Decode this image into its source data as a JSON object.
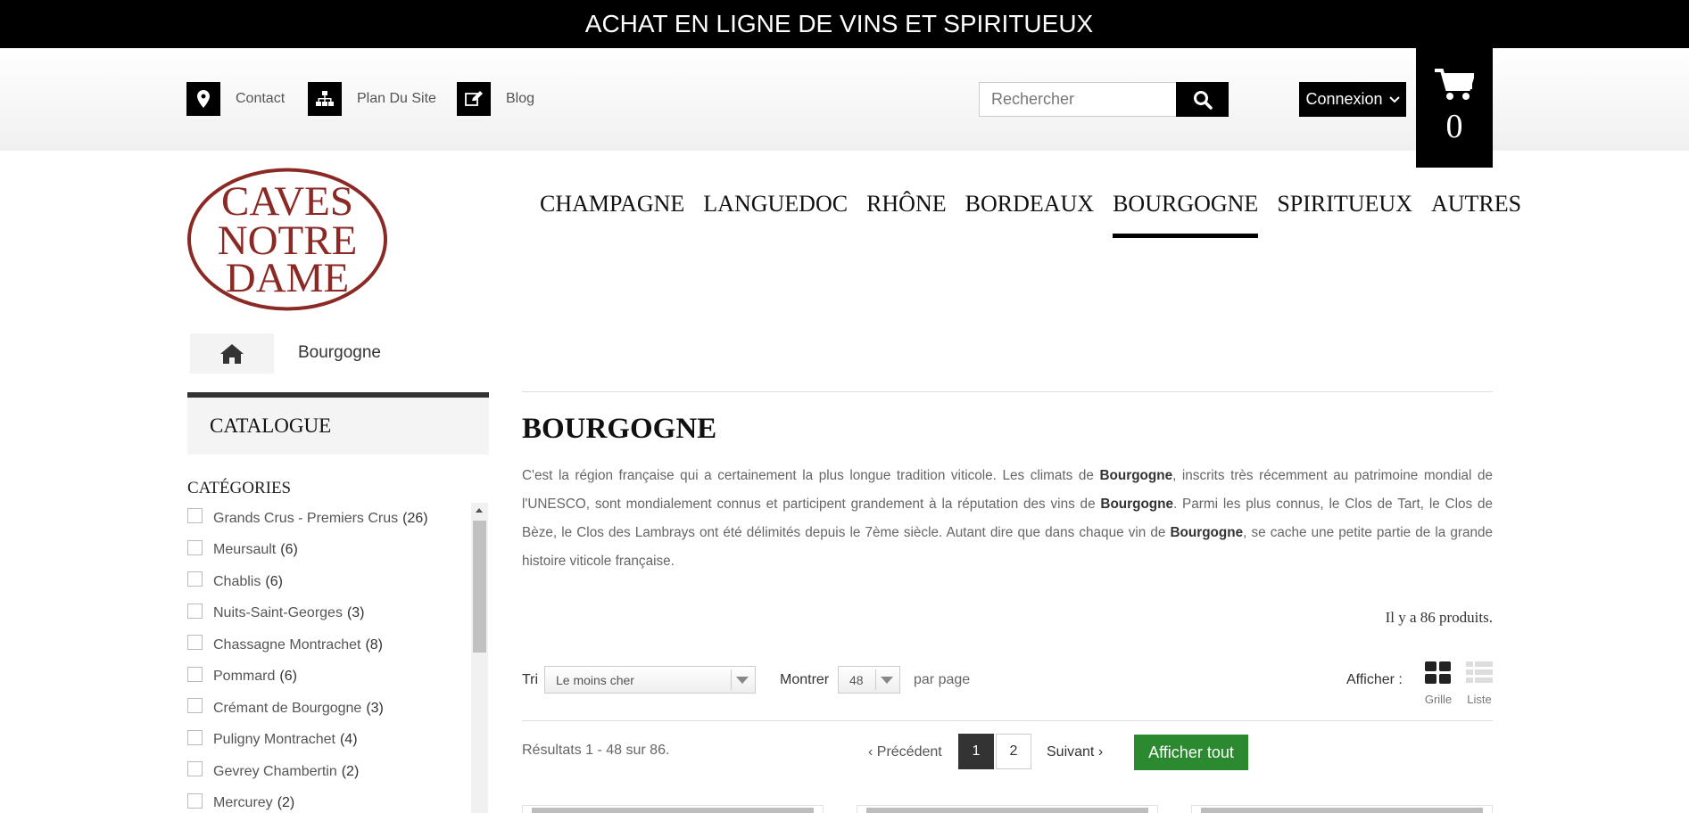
{
  "banner": {
    "title": "ACHAT EN LIGNE DE VINS ET SPIRITUEUX"
  },
  "header": {
    "links": [
      {
        "label": "Contact",
        "icon": "map-marker-icon"
      },
      {
        "label": "Plan Du Site",
        "icon": "sitemap-icon"
      },
      {
        "label": "Blog",
        "icon": "edit-icon"
      }
    ],
    "search": {
      "placeholder": "Rechercher",
      "value": ""
    },
    "login_label": "Connexion",
    "cart_count": "0"
  },
  "logo": {
    "line1": "CAVES",
    "line2": "NOTRE",
    "line3": "DAME"
  },
  "nav": {
    "items": [
      "CHAMPAGNE",
      "LANGUEDOC",
      "RHÔNE",
      "BORDEAUX",
      "BOURGOGNE",
      "SPIRITUEUX",
      "AUTRES"
    ],
    "active": "BOURGOGNE"
  },
  "breadcrumb": {
    "current": "Bourgogne"
  },
  "sidebar": {
    "catalogue_title": "CATALOGUE",
    "categories_title": "CATÉGORIES",
    "categories": [
      {
        "label": "Grands Crus - Premiers Crus",
        "count": "(26)"
      },
      {
        "label": "Meursault",
        "count": "(6)"
      },
      {
        "label": "Chablis",
        "count": "(6)"
      },
      {
        "label": "Nuits-Saint-Georges",
        "count": "(3)"
      },
      {
        "label": "Chassagne Montrachet",
        "count": "(8)"
      },
      {
        "label": "Pommard",
        "count": "(6)"
      },
      {
        "label": "Crémant de Bourgogne",
        "count": "(3)"
      },
      {
        "label": "Puligny Montrachet",
        "count": "(4)"
      },
      {
        "label": "Gevrey Chambertin",
        "count": "(2)"
      },
      {
        "label": "Mercurey",
        "count": "(2)"
      }
    ]
  },
  "main": {
    "title": "BOURGOGNE",
    "description": {
      "p1": "C'est la région française qui a certainement la plus longue tradition viticole. Les climats de ",
      "b1": "Bourgogne",
      "p2": ", inscrits très récemment au patrimoine mondial de l'UNESCO, sont mondialement connus et participent grandement à la réputation des vins de ",
      "b2": "Bourgogne",
      "p3": ". Parmi les plus connus, le Clos de Tart, le Clos de Bèze, le Clos des Lambrays ont été délimités depuis le 7ème siècle. Autant dire que dans chaque vin de ",
      "b3": "Bourgogne",
      "p4": ", se cache une petite partie de la grande histoire viticole française."
    },
    "product_count_text": "Il y a 86 produits.",
    "sort_label": "Tri",
    "sort_value": "Le moins cher",
    "show_label": "Montrer",
    "per_page_value": "48",
    "per_page_label": "par page",
    "view_label": "Afficher :",
    "view_grid": "Grille",
    "view_list": "Liste",
    "results_text": "Résultats 1 - 48 sur 86.",
    "prev_label": "Précédent",
    "pages": [
      "1",
      "2"
    ],
    "active_page": "1",
    "next_label": "Suivant",
    "show_all_label": "Afficher tout"
  },
  "colors": {
    "accent_green": "#2b8a2f",
    "logo_red": "#8b2a24",
    "dark": "#000000"
  }
}
